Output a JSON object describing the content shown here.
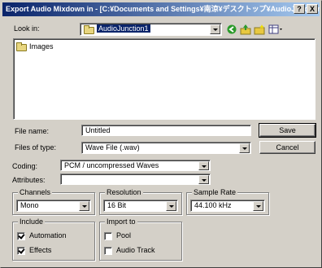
{
  "window": {
    "title": "Export Audio Mixdown in - [C:¥Documents and Settings¥南涼¥デスクトップ¥AudioJunction...",
    "help_btn": "?",
    "close_btn": "X"
  },
  "look_in": {
    "label": "Look in:",
    "value": "AudioJunction1",
    "toolbar_icons": [
      "back-icon",
      "up-folder-icon",
      "new-folder-icon",
      "view-menu-icon"
    ]
  },
  "file_list": {
    "items": [
      {
        "name": "Images",
        "icon": "folder-icon"
      }
    ]
  },
  "file_name": {
    "label": "File name:",
    "value": "Untitled"
  },
  "file_type": {
    "label": "Files of type:",
    "value": "Wave File (.wav)"
  },
  "buttons": {
    "save": "Save",
    "cancel": "Cancel"
  },
  "coding": {
    "label": "Coding:",
    "value": "PCM / uncompressed Waves"
  },
  "attributes": {
    "label": "Attributes:",
    "value": ""
  },
  "channels": {
    "title": "Channels",
    "value": "Mono"
  },
  "resolution": {
    "title": "Resolution",
    "value": "16 Bit"
  },
  "sample_rate": {
    "title": "Sample Rate",
    "value": "44.100 kHz"
  },
  "include": {
    "title": "Include",
    "automation": {
      "label": "Automation",
      "checked": true
    },
    "effects": {
      "label": "Effects",
      "checked": true
    }
  },
  "import_to": {
    "title": "Import to",
    "pool": {
      "label": "Pool",
      "checked": false
    },
    "audio_track": {
      "label": "Audio Track",
      "checked": false
    }
  },
  "colors": {
    "titlebar_start": "#0a246a",
    "titlebar_end": "#a6caf0",
    "face": "#d4d0c8"
  }
}
